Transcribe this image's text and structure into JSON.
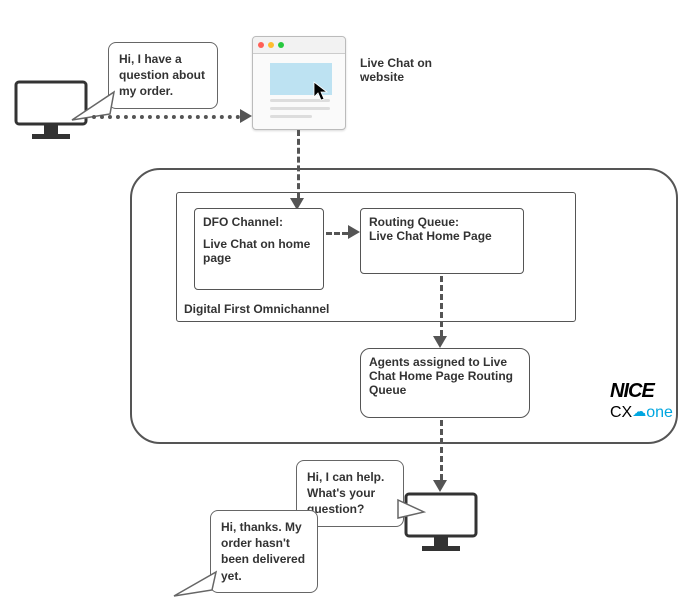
{
  "customer": {
    "bubble1": "Hi, I have a question about my order.",
    "bubble2": "Hi, thanks. My order hasn't been delivered yet."
  },
  "agent": {
    "bubble1": "Hi, I can help. What's your question?"
  },
  "labels": {
    "liveChatWebsite": "Live Chat on website",
    "dfoGroup": "Digital First Omnichannel"
  },
  "dfoChannel": {
    "title": "DFO Channel:",
    "body": "Live Chat on home page"
  },
  "routingQueue": {
    "title": "Routing Queue:",
    "body": "Live Chat Home Page"
  },
  "agentsBox": {
    "text": "Agents assigned to Live Chat Home Page Routing Queue"
  },
  "brand": {
    "nice": "NICE",
    "cx": "CX",
    "one": "one"
  }
}
